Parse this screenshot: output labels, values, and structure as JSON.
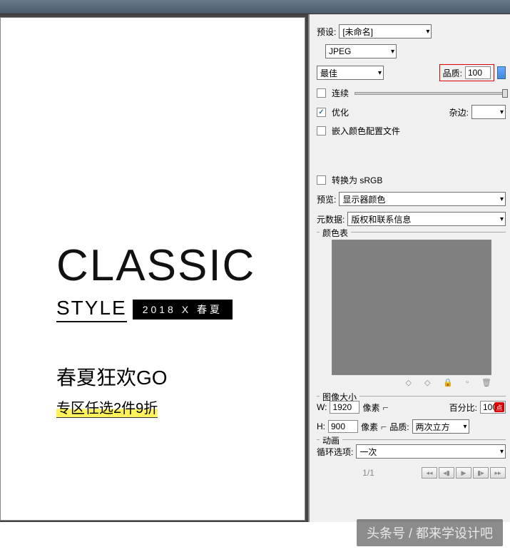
{
  "artwork": {
    "classic": "CLASSIC",
    "style": "STYLE",
    "badge": "2018 X 春夏",
    "promo1": "春夏狂欢GO",
    "promo2": "专区任选2件9折"
  },
  "preset": {
    "label": "预设:",
    "value": "[未命名]"
  },
  "format": {
    "value": "JPEG"
  },
  "quality_preset": {
    "value": "最佳"
  },
  "quality": {
    "label": "品质:",
    "value": "100"
  },
  "progressive": {
    "label": "连续",
    "checked": false
  },
  "optimized": {
    "label": "优化",
    "checked": true
  },
  "matte": {
    "label": "杂边:",
    "value": ""
  },
  "embed_profile": {
    "label": "嵌入颜色配置文件",
    "checked": false
  },
  "convert_srgb": {
    "label": "转换为 sRGB",
    "checked": false
  },
  "preview": {
    "label": "预览:",
    "value": "显示器颜色"
  },
  "metadata": {
    "label": "元数据:",
    "value": "版权和联系信息"
  },
  "color_table": {
    "title": "颜色表"
  },
  "image_size": {
    "title": "图像大小",
    "w_label": "W:",
    "w_value": "1920",
    "h_label": "H:",
    "h_value": "900",
    "unit": "像素",
    "percent_label": "百分比:",
    "percent_value": "100",
    "quality_label": "品质:",
    "quality_value": "两次立方",
    "red_badge": "点"
  },
  "animation": {
    "title": "动画",
    "loop_label": "循环选项:",
    "loop_value": "一次",
    "frame": "1/1"
  },
  "watermark": "头条号 / 都来学设计吧"
}
